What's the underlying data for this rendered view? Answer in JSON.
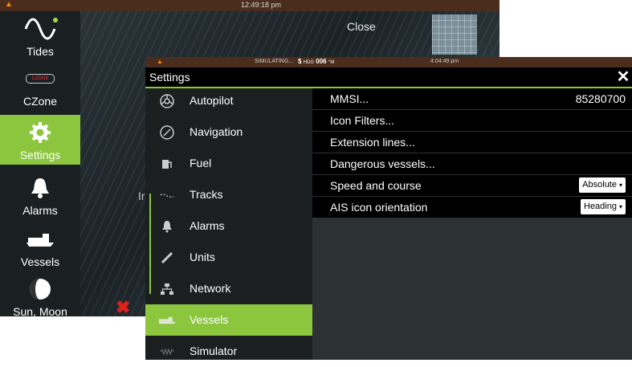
{
  "background": {
    "statusbar": {
      "time": "12:49:18 pm"
    },
    "close_label": "Close",
    "partial_text": "Ir",
    "sidebar": [
      {
        "icon": "sine-wave-icon",
        "label": "Tides"
      },
      {
        "icon": "czone-logo-icon",
        "label": "CZone"
      },
      {
        "icon": "gear-icon",
        "label": "Settings"
      },
      {
        "icon": "bell-icon",
        "label": "Alarms"
      },
      {
        "icon": "vessel-icon",
        "label": "Vessels"
      },
      {
        "icon": "moon-phase-icon",
        "label": "Sun, Moon"
      }
    ],
    "active_sidebar": "Settings"
  },
  "dialog": {
    "statusbar": {
      "sim": "SIMULATING...",
      "hdg_label": "HDG",
      "hdg_value": "006",
      "hdg_unit": "°M",
      "time": "4:04:49 pm"
    },
    "title": "Settings",
    "menu": [
      {
        "icon": "autopilot-icon",
        "label": "Autopilot"
      },
      {
        "icon": "compass-icon",
        "label": "Navigation"
      },
      {
        "icon": "fuel-icon",
        "label": "Fuel"
      },
      {
        "icon": "tracks-icon",
        "label": "Tracks"
      },
      {
        "icon": "bell-icon",
        "label": "Alarms"
      },
      {
        "icon": "ruler-icon",
        "label": "Units"
      },
      {
        "icon": "network-icon",
        "label": "Network"
      },
      {
        "icon": "vessel-icon",
        "label": "Vessels"
      },
      {
        "icon": "simulator-icon",
        "label": "Simulator"
      }
    ],
    "active_menu": "Vessels",
    "rows": [
      {
        "label": "MMSI...",
        "value": "85280700"
      },
      {
        "label": "Icon Filters..."
      },
      {
        "label": "Extension lines..."
      },
      {
        "label": "Dangerous vessels..."
      },
      {
        "label": "Speed and course",
        "dropdown": "Absolute"
      },
      {
        "label": "AIS icon orientation",
        "dropdown": "Heading"
      }
    ]
  },
  "colors": {
    "accent": "#8cc63f",
    "statusbar": "#4a2d1d",
    "warning": "#ff8a00",
    "alert_x": "#e0201a"
  }
}
